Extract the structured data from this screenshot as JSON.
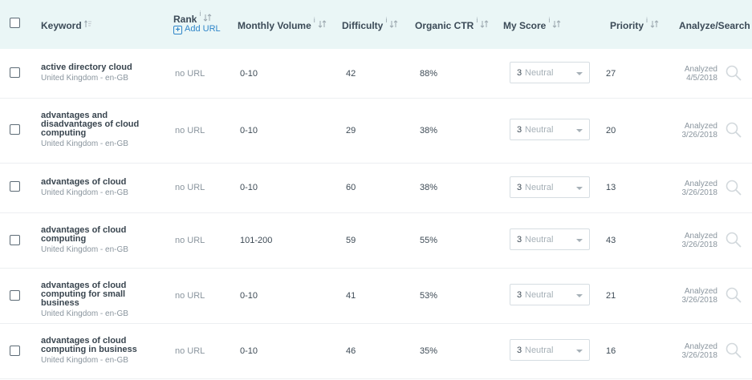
{
  "header": {
    "keyword": "Keyword",
    "rank": "Rank",
    "rank_info": "i",
    "add_url": "Add URL",
    "monthly_volume": "Monthly Volume",
    "difficulty": "Difficulty",
    "organic_ctr": "Organic CTR",
    "my_score": "My Score",
    "priority": "Priority",
    "analyze_search": "Analyze/Search",
    "info_marker": "i"
  },
  "rows": [
    {
      "keyword": [
        "active directory cloud"
      ],
      "locale": "United Kingdom - en-GB",
      "rank": "no URL",
      "volume": "0-10",
      "difficulty": "42",
      "ctr": "88%",
      "score_num": "3",
      "score_label": "Neutral",
      "priority": "27",
      "status": "Analyzed",
      "date": "4/5/2018"
    },
    {
      "keyword": [
        "advantages and",
        "disadvantages of cloud",
        "computing"
      ],
      "locale": "United Kingdom - en-GB",
      "rank": "no URL",
      "volume": "0-10",
      "difficulty": "29",
      "ctr": "38%",
      "score_num": "3",
      "score_label": "Neutral",
      "priority": "20",
      "status": "Analyzed",
      "date": "3/26/2018"
    },
    {
      "keyword": [
        "advantages of cloud"
      ],
      "locale": "United Kingdom - en-GB",
      "rank": "no URL",
      "volume": "0-10",
      "difficulty": "60",
      "ctr": "38%",
      "score_num": "3",
      "score_label": "Neutral",
      "priority": "13",
      "status": "Analyzed",
      "date": "3/26/2018"
    },
    {
      "keyword": [
        "advantages of cloud",
        "computing"
      ],
      "locale": "United Kingdom - en-GB",
      "rank": "no URL",
      "volume": "101-200",
      "difficulty": "59",
      "ctr": "55%",
      "score_num": "3",
      "score_label": "Neutral",
      "priority": "43",
      "status": "Analyzed",
      "date": "3/26/2018"
    },
    {
      "keyword": [
        "advantages of cloud",
        "computing for small business"
      ],
      "locale": "United Kingdom - en-GB",
      "rank": "no URL",
      "volume": "0-10",
      "difficulty": "41",
      "ctr": "53%",
      "score_num": "3",
      "score_label": "Neutral",
      "priority": "21",
      "status": "Analyzed",
      "date": "3/26/2018"
    },
    {
      "keyword": [
        "advantages of cloud",
        "computing in business"
      ],
      "locale": "United Kingdom - en-GB",
      "rank": "no URL",
      "volume": "0-10",
      "difficulty": "46",
      "ctr": "35%",
      "score_num": "3",
      "score_label": "Neutral",
      "priority": "16",
      "status": "Analyzed",
      "date": "3/26/2018"
    }
  ]
}
